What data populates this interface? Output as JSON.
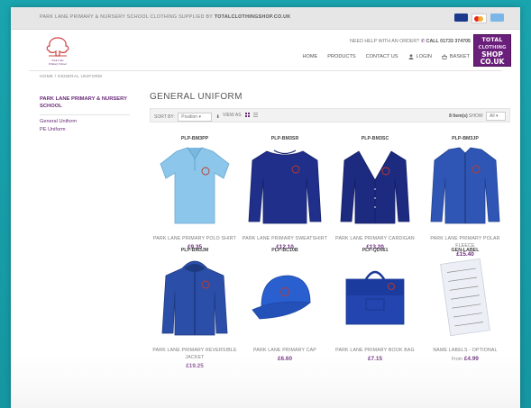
{
  "topbar": {
    "promo": "PARK LANE PRIMARY & NURSERY SCHOOL CLOTHING SUPPLIED BY ",
    "promo_link": "TOTALCLOTHINGSHOP.CO.UK",
    "payment_icons": [
      "visa-card-icon",
      "mastercard-icon",
      "amex-card-icon"
    ]
  },
  "header": {
    "school_logo": "Park Lane Primary School",
    "help_text": "NEED HELP WITH AN ORDER?",
    "phone": "CALL 01733 374705",
    "nav": [
      {
        "label": "HOME"
      },
      {
        "label": "PRODUCTS"
      },
      {
        "label": "CONTACT US"
      },
      {
        "label": "LOGIN",
        "icon": "user-icon"
      },
      {
        "label": "BASKET",
        "icon": "basket-icon"
      }
    ],
    "brand_logo": {
      "l1": "TOTAL",
      "l2": "CLOTHING",
      "l3": "SHOP",
      "l4": "CO.UK"
    }
  },
  "breadcrumb": "HOME / GENERAL UNIFORM",
  "sidebar": {
    "category": "PARK LANE PRIMARY & NURSERY SCHOOL",
    "links": [
      "General Uniform",
      "PE Uniform"
    ]
  },
  "main": {
    "title": "GENERAL UNIFORM",
    "toolbar": {
      "sort_label": "SORT BY:",
      "sort_value": "Position",
      "view_label": "VIEW AS",
      "items_count": "8 Item(s)",
      "show_label": "SHOW",
      "show_value": "All"
    }
  },
  "products": [
    {
      "sku": "PLP-BM3PP",
      "name": "PARK LANE PRIMARY POLO SHIRT",
      "price": "£9.35",
      "image": "polo-shirt"
    },
    {
      "sku": "PLP-BM3SR",
      "name": "PARK LANE PRIMARY SWEATSHIRT",
      "price": "£12.10",
      "image": "sweatshirt"
    },
    {
      "sku": "PLP-BM3SC",
      "name": "PARK LANE PRIMARY CARDIGAN",
      "price": "£13.20",
      "image": "cardigan"
    },
    {
      "sku": "PLP-BM3JP",
      "name": "PARK LANE PRIMARY POLAR FLEECE",
      "price": "£15.40",
      "image": "fleece"
    },
    {
      "sku": "PLP-BM3JM",
      "name": "PARK LANE PRIMARY REVERSIBLE JACKET",
      "price": "£19.25",
      "image": "jacket"
    },
    {
      "sku": "PLP-BC10B",
      "name": "PARK LANE PRIMARY CAP",
      "price": "£6.60",
      "image": "cap"
    },
    {
      "sku": "PLP-QD061",
      "name": "PARK LANE PRIMARY BOOK BAG",
      "price": "£7.15",
      "image": "book-bag"
    },
    {
      "sku": "GEN-LABEL",
      "name": "NAME LABELS - OPTIONAL",
      "price_prefix": "From",
      "price": "£4.99",
      "image": "name-labels"
    }
  ],
  "colors": {
    "accent": "#6a2a7a",
    "background": "#1a9aa6",
    "sky_blue": "#8cc6ea",
    "navy": "#1f2f8a",
    "royal_blue": "#2f56b4"
  }
}
